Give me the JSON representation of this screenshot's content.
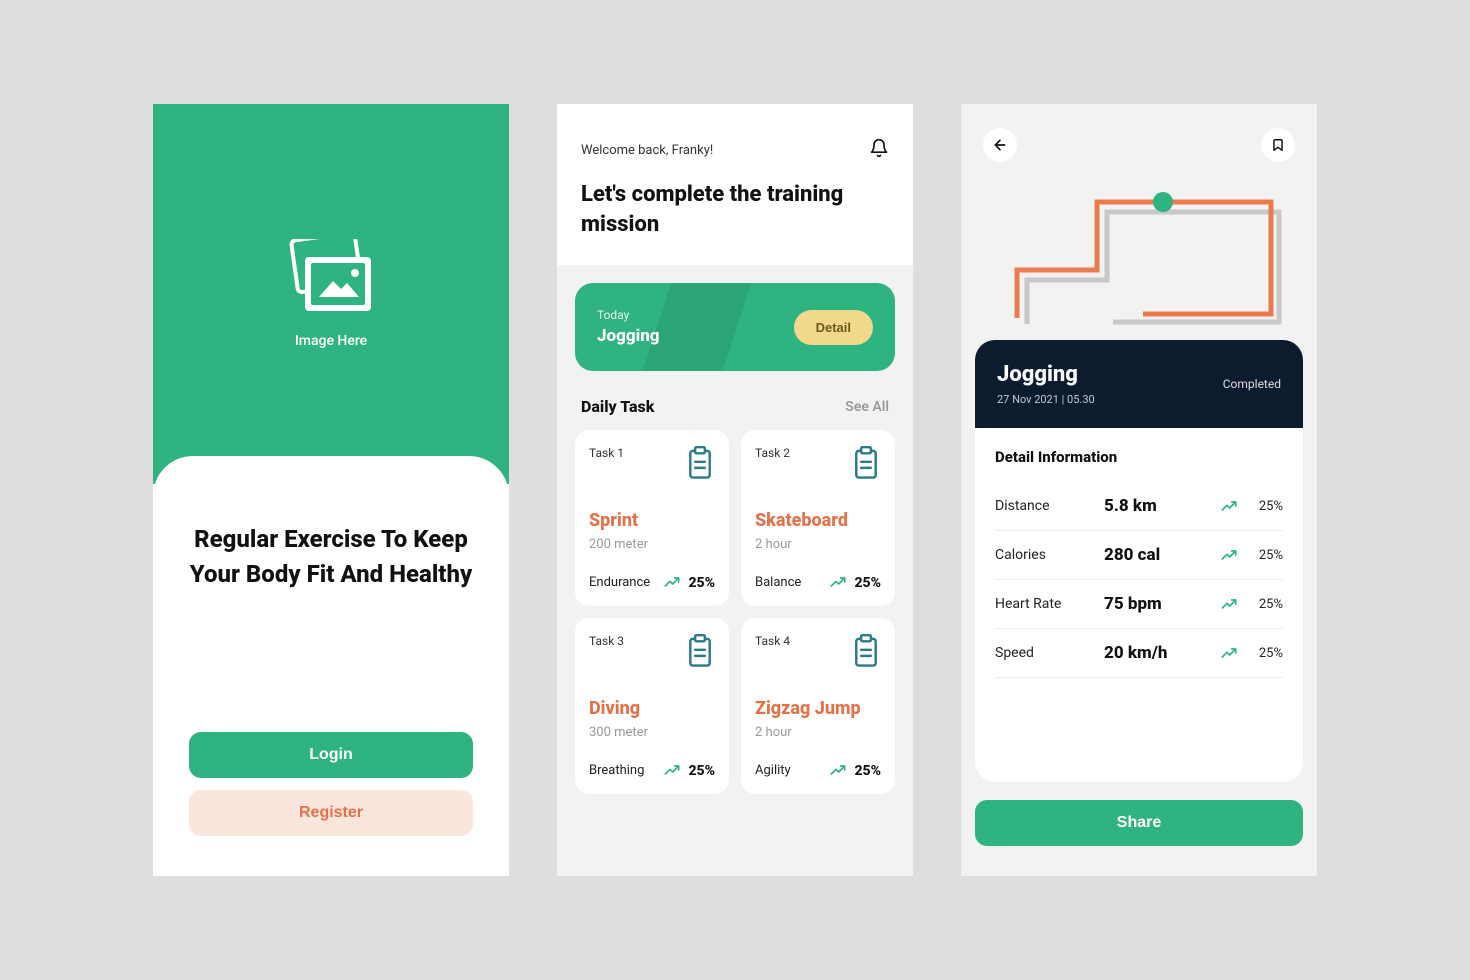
{
  "screen1": {
    "image_label": "Image Here",
    "headline": "Regular Exercise To Keep Your Body Fit And Healthy",
    "login_label": "Login",
    "register_label": "Register"
  },
  "screen2": {
    "welcome": "Welcome back, Franky!",
    "heading": "Let's complete the training mission",
    "today_label": "Today",
    "today_activity": "Jogging",
    "detail_label": "Detail",
    "daily_task_title": "Daily Task",
    "see_all": "See All",
    "tasks": [
      {
        "num": "Task 1",
        "name": "Sprint",
        "sub": "200 meter",
        "metric": "Endurance",
        "pct": "25%"
      },
      {
        "num": "Task 2",
        "name": "Skateboard",
        "sub": "2 hour",
        "metric": "Balance",
        "pct": "25%"
      },
      {
        "num": "Task 3",
        "name": "Diving",
        "sub": "300 meter",
        "metric": "Breathing",
        "pct": "25%"
      },
      {
        "num": "Task 4",
        "name": "Zigzag Jump",
        "sub": "2 hour",
        "metric": "Agility",
        "pct": "25%"
      }
    ]
  },
  "screen3": {
    "activity": "Jogging",
    "date": "27 Nov 2021 | 05.30",
    "status": "Completed",
    "detail_title": "Detail Information",
    "stats": [
      {
        "label": "Distance",
        "value": "5.8 km",
        "pct": "25%"
      },
      {
        "label": "Calories",
        "value": "280 cal",
        "pct": "25%"
      },
      {
        "label": "Heart Rate",
        "value": "75 bpm",
        "pct": "25%"
      },
      {
        "label": "Speed",
        "value": "20 km/h",
        "pct": "25%"
      }
    ],
    "share_label": "Share"
  }
}
